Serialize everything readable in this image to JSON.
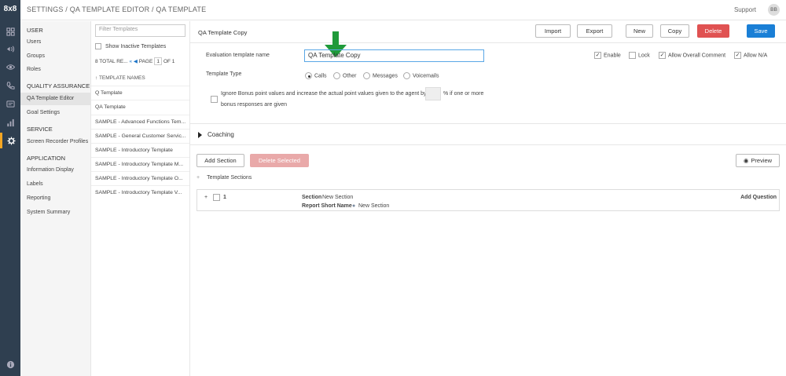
{
  "app": {
    "logo": "8x8",
    "breadcrumb": "SETTINGS / QA TEMPLATE EDITOR / QA TEMPLATE",
    "support_label": "Support",
    "avatar_initials": "BB",
    "accent_color": "#f5a623"
  },
  "rail_icons": [
    "dashboard-icon",
    "broadcast-icon",
    "eye-icon",
    "phone-icon",
    "message-icon",
    "chart-icon",
    "gear-icon",
    "info-icon"
  ],
  "nav": {
    "user_header": "USER",
    "users": "Users",
    "groups": "Groups",
    "roles": "Roles",
    "qa_header": "QUALITY ASSURANCE",
    "qa_template_editor": "QA Template Editor",
    "goal_settings": "Goal Settings",
    "service_header": "SERVICE",
    "screen_recorder_profiles": "Screen Recorder Profiles",
    "application_header": "APPLICATION",
    "information_display": "Information Display",
    "labels": "Labels",
    "reporting": "Reporting",
    "system_summary": "System Summary"
  },
  "template_list": {
    "filter_placeholder": "Filter Templates",
    "show_inactive": "Show Inactive Templates",
    "total": "8 TOTAL RE...",
    "page_label": "PAGE",
    "page_value": "1",
    "of_label": "OF 1",
    "column_header": "↑ TEMPLATE NAMES",
    "items": [
      "Q Template",
      "QA Template",
      "SAMPLE - Advanced Functions Tem...",
      "SAMPLE - General Customer Servic...",
      "SAMPLE - Introductory Template",
      "SAMPLE - Introductory Template M...",
      "SAMPLE - Introductory Template O...",
      "SAMPLE - Introductory Template V..."
    ]
  },
  "editor": {
    "template_title": "QA Template Copy",
    "buttons": {
      "import": "Import",
      "export": "Export",
      "new": "New",
      "copy": "Copy",
      "delete": "Delete",
      "save": "Save"
    },
    "eval_name_label": "Evaluation template name",
    "eval_name_value": "QA Template Copy",
    "flags": {
      "enable": "Enable",
      "lock": "Lock",
      "allow_overall_comment": "Allow Overall Comment",
      "allow_na": "Allow N/A"
    },
    "template_type_label": "Template Type",
    "types": {
      "calls": "Calls",
      "other": "Other",
      "messages": "Messages",
      "voicemails": "Voicemails"
    },
    "bonus_text_1": "Ignore Bonus point values and increase the actual point values given to the agent by",
    "bonus_text_2": "% if one or more",
    "bonus_text_3": "bonus responses are given",
    "coaching": "Coaching",
    "add_section": "Add Section",
    "delete_selected": "Delete Selected",
    "preview": "Preview",
    "template_sections": "Template Sections",
    "section_row": {
      "number": "1",
      "section_label": "Section",
      "section_value": "New Section",
      "short_name_label": "Report Short Name",
      "short_name_value": "New Section",
      "add_question": "Add Question"
    }
  }
}
